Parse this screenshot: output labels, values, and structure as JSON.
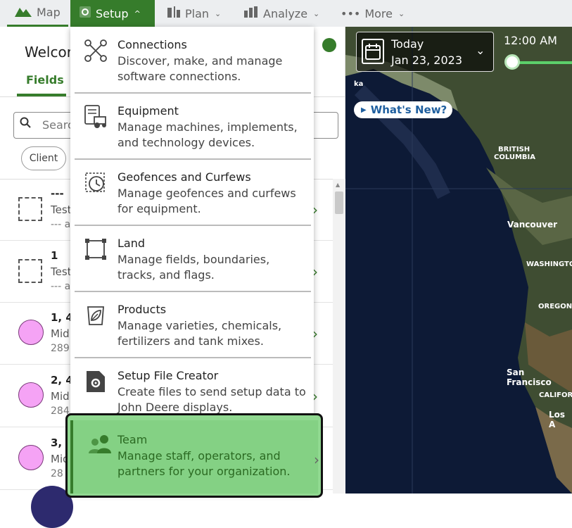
{
  "nav": {
    "map": "Map",
    "setup": "Setup",
    "plan": "Plan",
    "analyze": "Analyze",
    "more": "More"
  },
  "left_panel": {
    "welcome": "Welcor",
    "fields_tab": "Fields",
    "search_placeholder": "Searc",
    "chip": "Client",
    "rows": [
      {
        "t1": "---",
        "t2": "Test",
        "t3": "--- a"
      },
      {
        "t1": "1",
        "t2": "Test",
        "t3": "--- a"
      },
      {
        "t1": "1, 4",
        "t2": "Mid",
        "t3": "289"
      },
      {
        "t1": "2, 4",
        "t2": "Mid",
        "t3": "284"
      },
      {
        "t1": "3, 4",
        "t2": "Mid",
        "t3": "28"
      }
    ]
  },
  "dropdown": {
    "items": [
      {
        "title": "Connections",
        "desc": "Discover, make, and manage software connections."
      },
      {
        "title": "Equipment",
        "desc": "Manage machines, implements, and technology devices."
      },
      {
        "title": "Geofences and Curfews",
        "desc": "Manage geofences and curfews for equipment."
      },
      {
        "title": "Land",
        "desc": "Manage fields, boundaries, tracks, and flags."
      },
      {
        "title": "Products",
        "desc": "Manage varieties, chemicals, fertilizers and tank mixes."
      },
      {
        "title": "Setup File Creator",
        "desc": "Create files to send setup data to John Deere displays."
      }
    ],
    "team": {
      "title": "Team",
      "desc": "Manage staff, operators, and partners for your organization."
    }
  },
  "map": {
    "date_today": "Today",
    "date_value": "Jan 23, 2023",
    "time": "12:00 AM",
    "whats_new": "What's New?",
    "labels": {
      "ka": "ka",
      "british_columbia_1": "BRITISH",
      "british_columbia_2": "COLUMBIA",
      "vancouver": "Vancouver",
      "washington": "WASHINGTO",
      "oregon": "OREGON",
      "san_francisco": "San Francisco",
      "california": "CALIFOR",
      "los_angeles": "Los A"
    }
  }
}
